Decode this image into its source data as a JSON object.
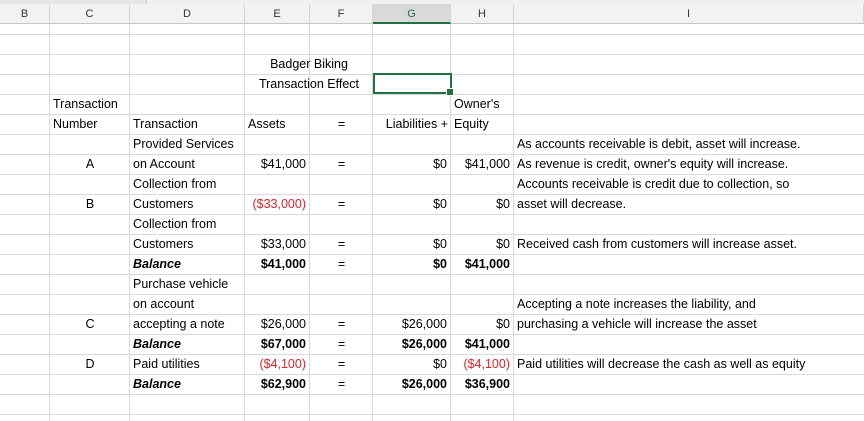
{
  "columns": [
    "B",
    "C",
    "D",
    "E",
    "F",
    "G",
    "H",
    "I"
  ],
  "title": {
    "company": "Badger Biking",
    "subtitle": "Transaction Effect"
  },
  "headers": {
    "transaction_line1": "Transaction",
    "number": "Number",
    "transaction": "Transaction",
    "assets": "Assets",
    "equals": "=",
    "liabilities": "Liabilities +",
    "owners_line1": "Owner's",
    "equity": "Equity"
  },
  "rows": {
    "a_desc1": "Provided Services",
    "a_desc2": "on Account",
    "a_id": "A",
    "a_assets": "$41,000",
    "a_eq": "=",
    "a_liab": "$0",
    "a_equity": "$41,000",
    "a_note1": "As accounts receivable is debit, asset will increase.",
    "a_note2": "As revenue is credit, owner's equity will increase.",
    "b_desc1": "Collection from",
    "b_desc2": "Customers",
    "b_id": "B",
    "b_assets": "($33,000)",
    "b_eq": "=",
    "b_liab": "$0",
    "b_equity": "$0",
    "b_note1": "Accounts receivable is credit due to collection, so",
    "b_note2": "asset will decrease.",
    "b2_desc1": "Collection from",
    "b2_desc2": "Customers",
    "b2_assets": "$33,000",
    "b2_eq": "=",
    "b2_liab": "$0",
    "b2_equity": "$0",
    "b2_note": "Received cash from customers will increase asset.",
    "bal1_label": "Balance",
    "bal1_assets": "$41,000",
    "bal1_eq": "=",
    "bal1_liab": "$0",
    "bal1_equity": "$41,000",
    "c_desc1": "Purchase vehicle",
    "c_desc2": "on account",
    "c_desc3": "accepting a note",
    "c_id": "C",
    "c_assets": "$26,000",
    "c_eq": "=",
    "c_liab": "$26,000",
    "c_equity": "$0",
    "c_note1": "Accepting a note increases the liability, and",
    "c_note2": "purchasing a vehicle will increase the asset",
    "bal2_label": "Balance",
    "bal2_assets": "$67,000",
    "bal2_eq": "=",
    "bal2_liab": "$26,000",
    "bal2_equity": "$41,000",
    "d_desc": "Paid utilities",
    "d_id": "D",
    "d_assets": "($4,100)",
    "d_eq": "=",
    "d_liab": "$0",
    "d_equity": "($4,100)",
    "d_note": "Paid utilities will decrease the cash as well as equity",
    "bal3_label": "Balance",
    "bal3_assets": "$62,900",
    "bal3_eq": "=",
    "bal3_liab": "$26,000",
    "bal3_equity": "$36,900"
  },
  "colors": {
    "negative": "#e0202a",
    "selection": "#217346"
  }
}
